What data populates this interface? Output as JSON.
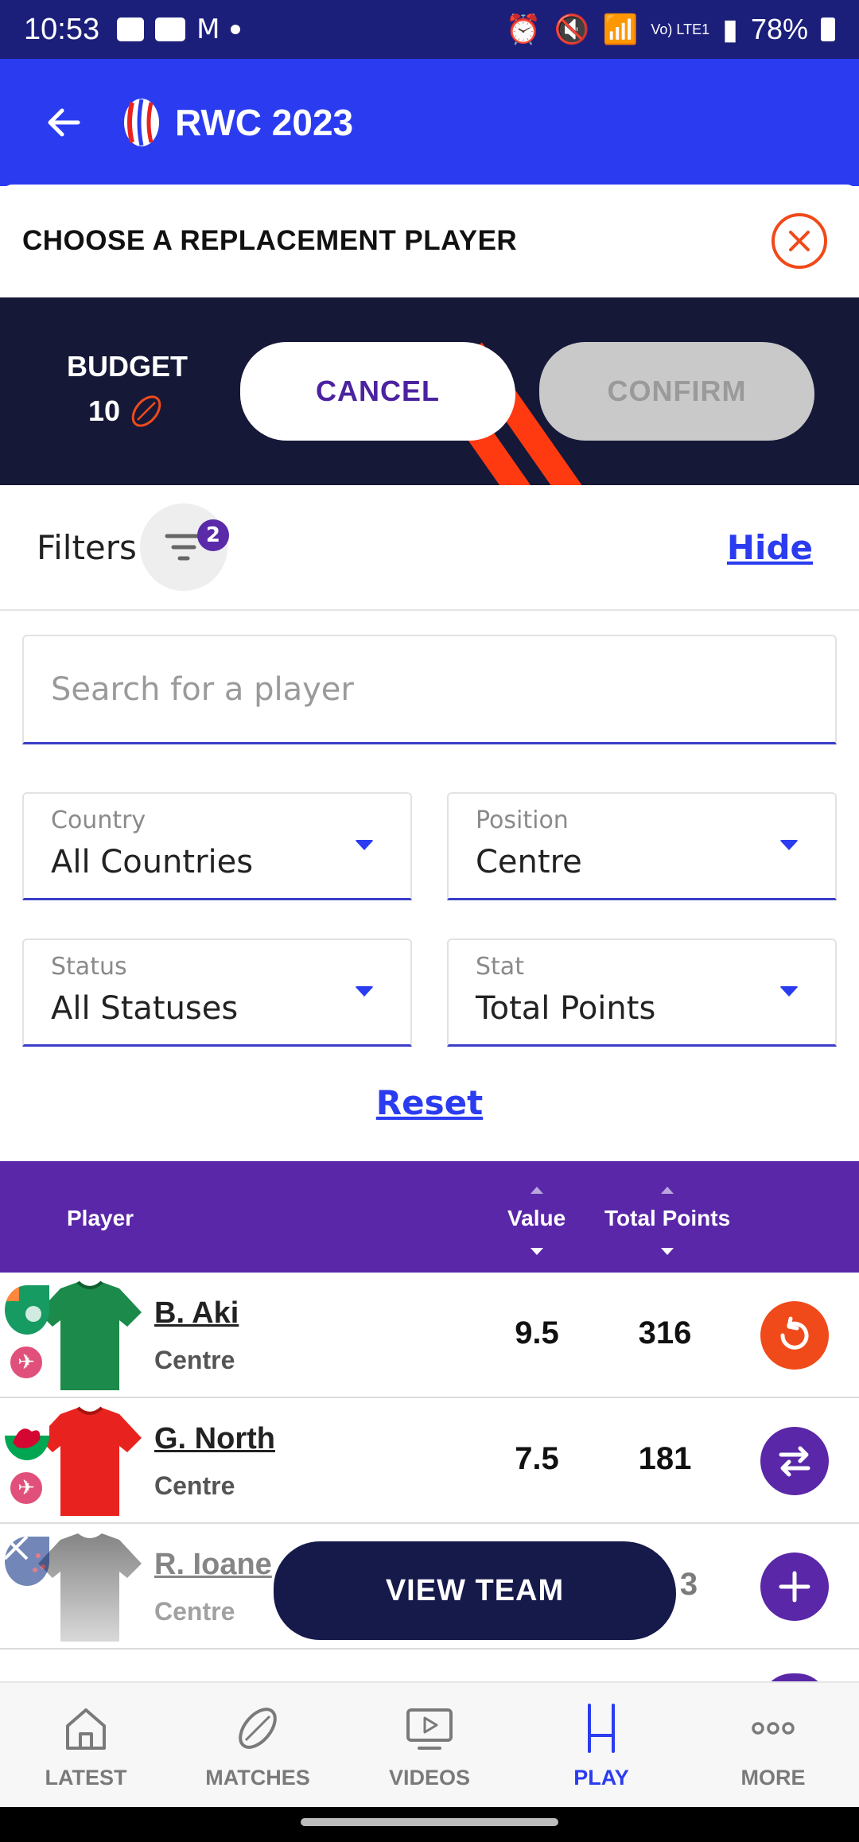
{
  "status_bar": {
    "time": "10:53",
    "battery": "78%",
    "network": "Vo) LTE1"
  },
  "app_bar": {
    "title": "RWC 2023"
  },
  "sheet": {
    "title": "CHOOSE A REPLACEMENT PLAYER"
  },
  "budget": {
    "label": "BUDGET",
    "value": "10"
  },
  "actions": {
    "cancel": "CANCEL",
    "confirm": "CONFIRM"
  },
  "filters": {
    "label": "Filters",
    "badge_count": "2",
    "hide": "Hide"
  },
  "search": {
    "placeholder": "Search for a player",
    "value": ""
  },
  "dropdowns": {
    "country": {
      "label": "Country",
      "value": "All Countries"
    },
    "position": {
      "label": "Position",
      "value": "Centre"
    },
    "status": {
      "label": "Status",
      "value": "All Statuses"
    },
    "stat": {
      "label": "Stat",
      "value": "Total Points"
    }
  },
  "reset": "Reset",
  "table": {
    "headers": {
      "player": "Player",
      "value": "Value",
      "points": "Total Points"
    },
    "rows": [
      {
        "name": "B. Aki",
        "position": "Centre",
        "value": "9.5",
        "points": "316",
        "action": "restore-icon",
        "jersey_color": "#1c8a4a",
        "flag": "ireland"
      },
      {
        "name": "G. North",
        "position": "Centre",
        "value": "7.5",
        "points": "181",
        "action": "swap-icon",
        "jersey_color": "#e8231f",
        "flag": "wales"
      },
      {
        "name": "R. Ioane",
        "position": "Centre",
        "value": "",
        "points": "3",
        "action": "plus-icon",
        "jersey_color": "#222222",
        "flag": "new-zealand"
      }
    ]
  },
  "view_team": "VIEW TEAM",
  "bottom_nav": [
    {
      "label": "LATEST",
      "icon": "home-icon"
    },
    {
      "label": "MATCHES",
      "icon": "rugby-ball-icon"
    },
    {
      "label": "VIDEOS",
      "icon": "video-play-icon"
    },
    {
      "label": "PLAY",
      "icon": "goal-posts-icon",
      "active": true
    },
    {
      "label": "MORE",
      "icon": "more-dots-icon"
    }
  ],
  "colors": {
    "primary": "#2b3cf0",
    "header_bg": "#1b1f7a",
    "purple": "#5a27a8",
    "accent_orange": "#f04a1a",
    "navy": "#161838"
  }
}
